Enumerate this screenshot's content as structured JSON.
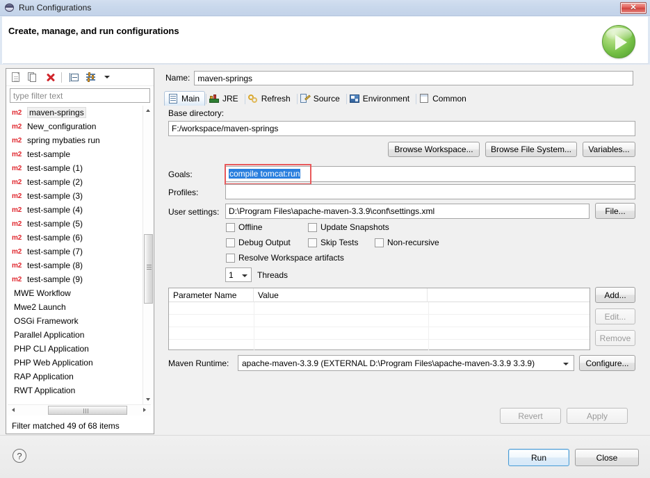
{
  "window": {
    "title": "Run Configurations",
    "icon": "eclipse-disc-icon",
    "close_label": "✕"
  },
  "header": {
    "title": "Create, manage, and run configurations",
    "badge_icon": "run-play-icon"
  },
  "left_panel": {
    "toolbar": [
      {
        "name": "new-launch-configuration-icon",
        "tooltip": "New launch configuration"
      },
      {
        "name": "duplicate-icon",
        "tooltip": "Duplicate"
      },
      {
        "name": "delete-icon",
        "tooltip": "Delete"
      },
      {
        "name": "collapse-all-icon",
        "tooltip": "Collapse All"
      },
      {
        "name": "filter-icon",
        "tooltip": "Filter launch configurations"
      },
      {
        "name": "chevron-down-icon",
        "tooltip": "View Menu"
      }
    ],
    "filter": {
      "placeholder": "type filter text",
      "value": ""
    },
    "tree_items": [
      {
        "label": "maven-springs",
        "icon": "m2",
        "selected": true
      },
      {
        "label": "New_configuration",
        "icon": "m2",
        "selected": false
      },
      {
        "label": "spring mybaties run",
        "icon": "m2",
        "selected": false
      },
      {
        "label": "test-sample",
        "icon": "m2",
        "selected": false
      },
      {
        "label": "test-sample (1)",
        "icon": "m2",
        "selected": false
      },
      {
        "label": "test-sample (2)",
        "icon": "m2",
        "selected": false
      },
      {
        "label": "test-sample (3)",
        "icon": "m2",
        "selected": false
      },
      {
        "label": "test-sample (4)",
        "icon": "m2",
        "selected": false
      },
      {
        "label": "test-sample (5)",
        "icon": "m2",
        "selected": false
      },
      {
        "label": "test-sample (6)",
        "icon": "m2",
        "selected": false
      },
      {
        "label": "test-sample (7)",
        "icon": "m2",
        "selected": false
      },
      {
        "label": "test-sample (8)",
        "icon": "m2",
        "selected": false
      },
      {
        "label": "test-sample (9)",
        "icon": "m2",
        "selected": false
      },
      {
        "label": "MWE Workflow",
        "icon": "",
        "selected": false
      },
      {
        "label": "Mwe2 Launch",
        "icon": "",
        "selected": false
      },
      {
        "label": "OSGi Framework",
        "icon": "",
        "selected": false
      },
      {
        "label": "Parallel Application",
        "icon": "",
        "selected": false
      },
      {
        "label": "PHP CLI Application",
        "icon": "",
        "selected": false
      },
      {
        "label": "PHP Web Application",
        "icon": "",
        "selected": false
      },
      {
        "label": "RAP Application",
        "icon": "",
        "selected": false
      },
      {
        "label": "RWT Application",
        "icon": "",
        "selected": false
      }
    ],
    "status": "Filter matched 49 of 68 items"
  },
  "right_panel": {
    "name_label": "Name:",
    "name_value": "maven-springs",
    "tabs": [
      {
        "label": "Main",
        "icon": "main-page-icon",
        "active": true
      },
      {
        "label": "JRE",
        "icon": "jre-icon",
        "active": false
      },
      {
        "label": "Refresh",
        "icon": "refresh-icon",
        "active": false
      },
      {
        "label": "Source",
        "icon": "source-icon",
        "active": false
      },
      {
        "label": "Environment",
        "icon": "environment-icon",
        "active": false
      },
      {
        "label": "Common",
        "icon": "common-icon",
        "active": false
      }
    ],
    "main_tab": {
      "base_directory_label": "Base directory:",
      "base_directory_value": "F:/workspace/maven-springs",
      "browse_workspace_label": "Browse Workspace...",
      "browse_filesystem_label": "Browse File System...",
      "variables_label": "Variables...",
      "goals_label": "Goals:",
      "goals_value": "compile tomcat:run",
      "goals_selected": true,
      "profiles_label": "Profiles:",
      "profiles_value": "",
      "user_settings_label": "User settings:",
      "user_settings_value": "D:\\Program Files\\apache-maven-3.3.9\\conf\\settings.xml",
      "file_button_label": "File...",
      "checkboxes": [
        {
          "label": "Offline",
          "checked": false
        },
        {
          "label": "Update Snapshots",
          "checked": false
        },
        {
          "label": "Debug Output",
          "checked": false
        },
        {
          "label": "Skip Tests",
          "checked": false
        },
        {
          "label": "Non-recursive",
          "checked": false
        },
        {
          "label": "Resolve Workspace artifacts",
          "checked": false
        }
      ],
      "threads_value": "1",
      "threads_label": "Threads",
      "parameter_table": {
        "columns": [
          "Parameter Name",
          "Value"
        ],
        "rows": []
      },
      "add_label": "Add...",
      "edit_label": "Edit...",
      "remove_label": "Remove",
      "maven_runtime_label": "Maven Runtime:",
      "maven_runtime_value": "apache-maven-3.3.9 (EXTERNAL D:\\Program Files\\apache-maven-3.3.9 3.3.9)",
      "configure_label": "Configure..."
    },
    "revert_label": "Revert",
    "apply_label": "Apply"
  },
  "footer": {
    "help_glyph": "?",
    "run_label": "Run",
    "close_label": "Close"
  },
  "colors": {
    "accent_blue": "#2a7fde",
    "annotation_red": "#e8595b",
    "m2_red": "#e0272e",
    "run_green": "#74bf45",
    "titlebar": "#c9d8ec"
  }
}
